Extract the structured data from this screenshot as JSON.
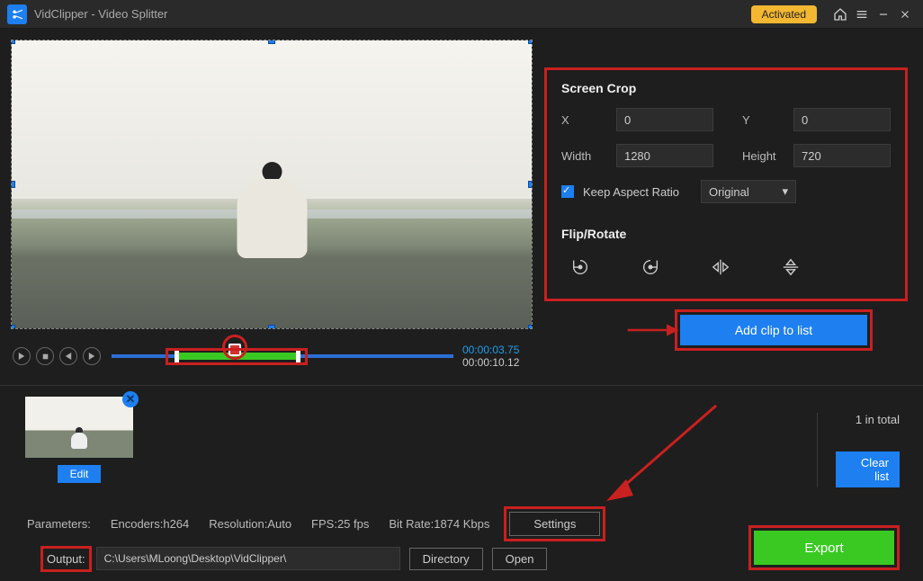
{
  "titlebar": {
    "title": "VidClipper - Video Splitter",
    "activated": "Activated"
  },
  "crop": {
    "title": "Screen Crop",
    "x_label": "X",
    "x_value": "0",
    "y_label": "Y",
    "y_value": "0",
    "w_label": "Width",
    "w_value": "1280",
    "h_label": "Height",
    "h_value": "720",
    "aspect_label": "Keep Aspect Ratio",
    "aspect_select": "Original",
    "flip_title": "Flip/Rotate"
  },
  "timeline": {
    "current": "00:00:03.75",
    "total": "00:00:10.12"
  },
  "actions": {
    "add_clip": "Add clip to list",
    "edit": "Edit",
    "clear": "Clear list",
    "settings": "Settings",
    "directory": "Directory",
    "open": "Open",
    "export": "Export"
  },
  "list": {
    "total": "1 in total"
  },
  "params": {
    "label": "Parameters:",
    "encoders": "Encoders:h264",
    "resolution": "Resolution:Auto",
    "fps": "FPS:25 fps",
    "bitrate": "Bit Rate:1874 Kbps"
  },
  "output": {
    "label": "Output:",
    "path": "C:\\Users\\MLoong\\Desktop\\VidClipper\\"
  }
}
